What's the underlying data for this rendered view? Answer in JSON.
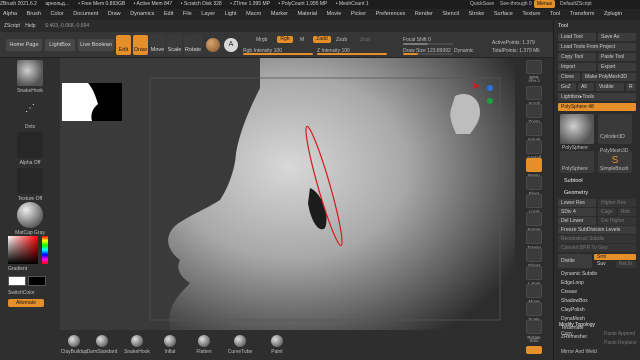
{
  "title_bar": {
    "items": [
      "ZBrush 2021.6.2",
      "арнольд…",
      "• Free Mem 0.893GB",
      "• Active Mem 847",
      "• Scratch Disk 328",
      "• ZTime 1.995 MP",
      "• PolyCount 1.995 MP",
      "• MeshCount 1"
    ],
    "quicksave": "QuickSave",
    "seethrough": "See-through 0",
    "menus_label": "Menus",
    "script": "DefaultZScript"
  },
  "menu": [
    "Alpha",
    "Brush",
    "Color",
    "Document",
    "Draw",
    "Dynamics",
    "Edit",
    "File",
    "Layer",
    "Light",
    "Macro",
    "Marker",
    "Material",
    "Movie",
    "Picker",
    "Preferences",
    "Render",
    "Stencil",
    "Stroke",
    "Surface",
    "Texture",
    "Tool",
    "Transform",
    "Zplugin"
  ],
  "submenu": [
    "ZScript",
    "Help"
  ],
  "coords": "S:403,-0.068,-0.694",
  "toolbar": {
    "home": "Home Page",
    "lightbox": "LightBox",
    "live_boolean": "Live Boolean",
    "edit": "Edit",
    "draw": "Draw",
    "move": "Move",
    "scale": "Scale",
    "rotate": "Rotate",
    "a_label": "A",
    "mrgb": "Mrgb",
    "rgb": "Rgb",
    "m": "M",
    "rgb_intensity": "Rgb Intensity 100",
    "zadd": "Zadd",
    "zsub": "Zsub",
    "zcut": "Zcut",
    "z_intensity": "Z Intensity 100",
    "focal": "Focal Shift 0",
    "draw_size": "Draw Size 123.89992",
    "dynamic": "Dynamic",
    "active_points": "ActivePoints: 1.379",
    "total_points": "TotalPoints: 1.379 Mil"
  },
  "left_panel": {
    "brush": "SnakeHook",
    "stroke": "Dots",
    "alpha": "Alpha Off",
    "texture": "Texture Off",
    "material": "MatCap Gray",
    "gradient": "Gradient",
    "switch": "SwitchColor",
    "alternate": "Alternate"
  },
  "right_strip": [
    "BPR",
    "SPix 3",
    "Scroll",
    "Zoom",
    "Actual",
    "AAHalf",
    "Persp",
    "Floor",
    "Local",
    "Frame",
    "Transp",
    "Ghost",
    "L.Sym",
    "Move",
    "Scale",
    "Rotate",
    "Solo",
    "Xpose"
  ],
  "tray": {
    "tool_label": "Tool",
    "load_tool": "Load Tool",
    "save_as": "Save As",
    "load_tools_project": "Load Tools From Project",
    "copy_tool": "Copy Tool",
    "paste_tool": "Paste Tool",
    "import": "Import",
    "export": "Export",
    "clone": "Clone",
    "make_polymesh": "Make PolyMesh3D",
    "goz": "GoZ",
    "all": "All",
    "visible": "Visible",
    "r": "R",
    "lightbox_tools": "Lightbox▸Tools",
    "polysphere": "PolySphere 48",
    "thumbs": [
      "PolySphere",
      "Cylinder3D",
      "PolySphere",
      "PolyMesh3D",
      "SimpleBrush"
    ],
    "subtool": "Subtool",
    "geometry": "Geometry",
    "lower_res": "Lower Res",
    "higher_res": "Higher Res",
    "sdiv": "SDiv 4",
    "cage": "Cage",
    "rstr": "Rstr",
    "del_lower": "Del Lower",
    "del_higher": "Del Higher",
    "freeze": "Freeze SubDivision Levels",
    "reconstruct": "Reconstruct Subdiv",
    "convert_bpr": "Convert BPR To Geo",
    "divide": "Divide",
    "smt": "Smt",
    "suv": "Suv",
    "reuv": "ReUV",
    "dynamic_subdiv": "Dynamic Subdiv",
    "edgeloop": "EdgeLoop",
    "crease": "Crease",
    "shadowbox": "ShadowBox",
    "claypolish": "ClayPolish",
    "dynamesh": "DynaMesh",
    "tessimate": "Tessimate",
    "zremesher": "ZRemesher",
    "modify_topology": "Modify Topology",
    "copy": "Copy",
    "paste_append": "Paste Append",
    "paste_replace": "Paste Replace",
    "mirror_weld": "Mirror And Weld"
  },
  "shelf": [
    "ClayBuildup",
    "DamStandard",
    "SnakeHook",
    "Inflat",
    "Flatten",
    "CurveTube",
    "Paint"
  ],
  "colors": {
    "accent": "#e58f2a",
    "bg": "#2a2a2a",
    "canvas": "#3a3a3a"
  }
}
